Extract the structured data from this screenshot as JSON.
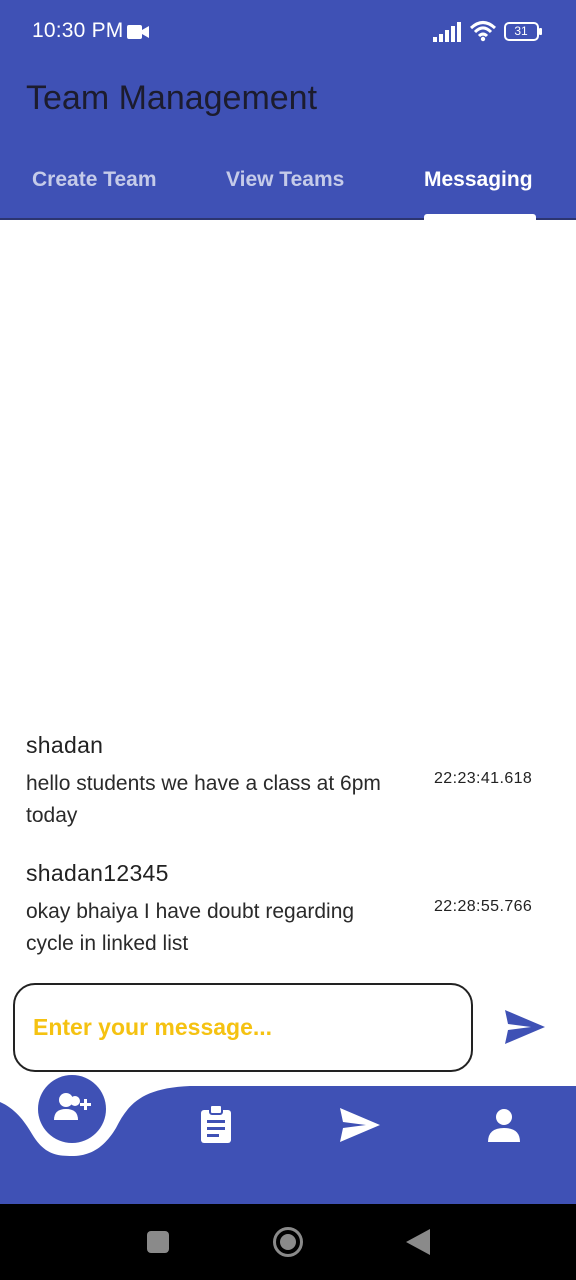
{
  "status_bar": {
    "time": "10:30 PM",
    "battery_level": "31",
    "icons": [
      "video-camera-icon",
      "signal-icon",
      "wifi-icon",
      "battery-icon"
    ]
  },
  "app_bar": {
    "title": "Team Management",
    "tabs": [
      {
        "label": "Create Team",
        "active": false
      },
      {
        "label": "View Teams",
        "active": false
      },
      {
        "label": "Messaging",
        "active": true
      }
    ]
  },
  "messages": [
    {
      "sender": "shadan",
      "text": "hello students we have a class at 6pm today",
      "time": "22:23:41.618"
    },
    {
      "sender": "shadan12345",
      "text": "okay bhaiya I have doubt regarding cycle in linked list",
      "time": "22:28:55.766"
    }
  ],
  "composer": {
    "placeholder": "Enter your message...",
    "value": "",
    "send_icon": "send-icon"
  },
  "bottom_nav": {
    "items": [
      "add-user-icon",
      "clipboard-icon",
      "send-icon",
      "person-icon"
    ],
    "selected_index": 0
  },
  "system_nav": {
    "items": [
      "recent-apps-icon",
      "home-icon",
      "back-icon"
    ]
  },
  "colors": {
    "primary": "#3f51b5",
    "placeholder": "#f5c211",
    "background": "#ffffff",
    "system_bar": "#000000"
  }
}
